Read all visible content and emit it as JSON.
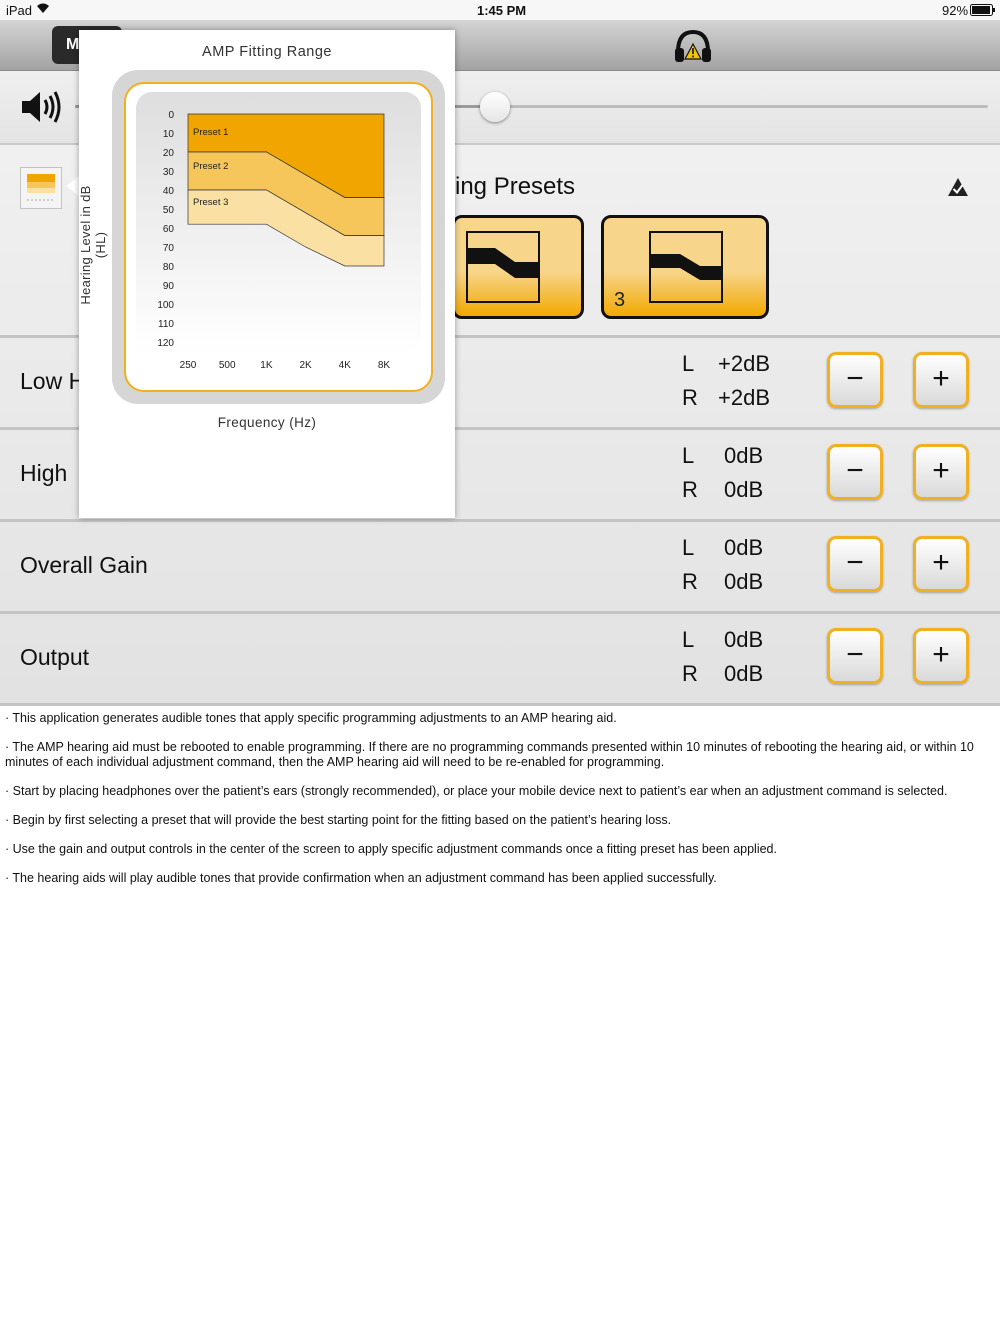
{
  "status_bar": {
    "device": "iPad",
    "time": "1:45 PM",
    "battery": "92%"
  },
  "toolbar": {
    "menu_label": "M"
  },
  "presets": {
    "title": "ing Presets",
    "card_number": "3"
  },
  "controls": [
    {
      "label": "Low H",
      "l_label": "L",
      "l_value": "+2dB",
      "r_label": "R",
      "r_value": "+2dB",
      "minus": "−",
      "plus": "+"
    },
    {
      "label": "High",
      "l_label": "L",
      "l_value": "0dB",
      "r_label": "R",
      "r_value": "0dB",
      "minus": "−",
      "plus": "+"
    },
    {
      "label": "Overall Gain",
      "l_label": "L",
      "l_value": "0dB",
      "r_label": "R",
      "r_value": "0dB",
      "minus": "−",
      "plus": "+"
    },
    {
      "label": "Output",
      "l_label": "L",
      "l_value": "0dB",
      "r_label": "R",
      "r_value": "0dB",
      "minus": "−",
      "plus": "+"
    }
  ],
  "volume": {
    "level": 0.46
  },
  "info": [
    "· This application generates audible tones that apply specific programming adjustments to an AMP hearing aid.",
    "· The AMP hearing aid must be rebooted to enable programming. If there are no programming commands presented within 10 minutes of rebooting the hearing aid, or within 10 minutes of each individual adjustment command, then the AMP hearing aid will need to be re-enabled for programming.",
    "· Start by placing headphones over the patient’s ears (strongly recommended), or place your mobile device next to patient’s ear when an adjustment command is selected.",
    "· Begin by first selecting a preset that will provide the best starting point for the fitting based on the patient’s hearing loss.",
    "· Use the gain and output controls in the center of the screen to apply specific adjustment commands once a fitting preset has been applied.",
    "· The hearing aids will play audible tones that provide confirmation when an adjustment command has been applied successfully."
  ],
  "popup": {
    "title": "AMP Fitting Range",
    "xlabel": "Frequency (Hz)",
    "ylabel": "Hearing Level in dB (HL)"
  },
  "chart_data": {
    "type": "area",
    "title": "AMP Fitting Range",
    "xlabel": "Frequency (Hz)",
    "ylabel": "Hearing Level in dB (HL)",
    "x": [
      "250",
      "500",
      "1K",
      "2K",
      "4K",
      "8K"
    ],
    "y_ticks": [
      0,
      10,
      20,
      30,
      40,
      50,
      60,
      70,
      80,
      90,
      100,
      110,
      120
    ],
    "ylim": [
      0,
      120
    ],
    "y_inverted": true,
    "series": [
      {
        "name": "Preset 1",
        "color": "#f0a500",
        "upper": [
          0,
          0,
          0,
          0,
          0,
          0
        ],
        "lower": [
          20,
          20,
          20,
          32,
          44,
          44
        ]
      },
      {
        "name": "Preset 2",
        "color": "#f7c65a",
        "upper": [
          20,
          20,
          20,
          32,
          44,
          44
        ],
        "lower": [
          40,
          40,
          40,
          52,
          64,
          64
        ]
      },
      {
        "name": "Preset 3",
        "color": "#fbe0a3",
        "upper": [
          40,
          40,
          40,
          52,
          64,
          64
        ],
        "lower": [
          58,
          58,
          58,
          70,
          80,
          80
        ]
      }
    ]
  }
}
